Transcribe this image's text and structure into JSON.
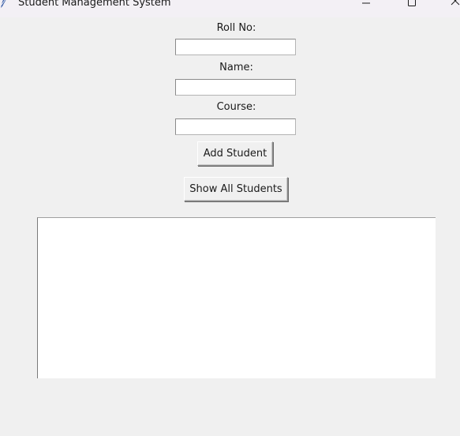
{
  "window": {
    "title": "Student Management System"
  },
  "form": {
    "roll_label": "Roll No:",
    "roll_value": "",
    "name_label": "Name:",
    "name_value": "",
    "course_label": "Course:",
    "course_value": ""
  },
  "buttons": {
    "add_label": "Add Student",
    "show_all_label": "Show All Students"
  },
  "listbox": {
    "items": []
  },
  "icons": {
    "app": "feather-icon",
    "minimize": "minimize-icon",
    "maximize": "maximize-icon",
    "close": "close-icon"
  }
}
